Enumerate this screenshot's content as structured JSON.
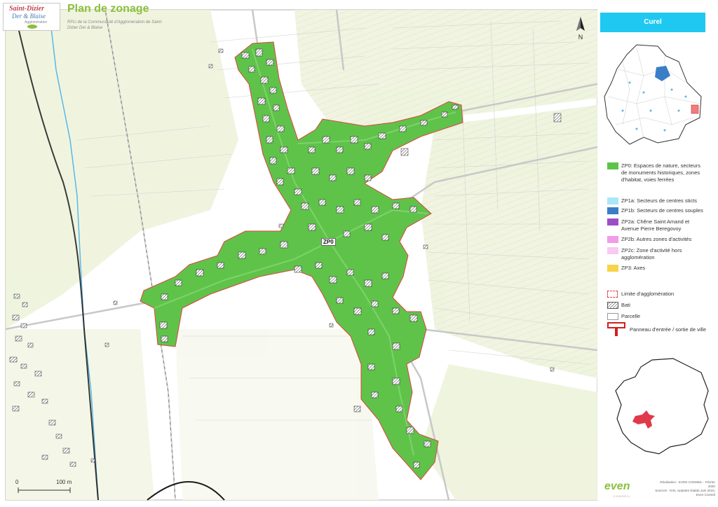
{
  "header": {
    "logo_line1": "Saint-Dizier",
    "logo_line2": "Der & Blaise",
    "logo_line3": "Agglomération",
    "title": "Plan de zonage",
    "subtitle": "RPLi de la Communauté d'Agglomération de Saint-Dizier Der & Blaise"
  },
  "map": {
    "north_label": "N",
    "zone_label": "ZP0",
    "scale_start": "0",
    "scale_end": "100 m",
    "colors": {
      "zone_fill": "#5fc34a",
      "zone_border": "#e04040",
      "parcel_line": "#cfcfcf",
      "terrain": "#eaf0d6",
      "river": "#5ab7e6",
      "railway": "#999999"
    }
  },
  "panel": {
    "commune_name": "Curel",
    "legend": [
      {
        "label": "ZP0: Espaces de nature, secteurs de monuments historiques, zones d'habitat, voies ferrées",
        "color": "#5fc34a"
      },
      {
        "label": "ZP1a: Secteurs de centres sticts",
        "color": "#a8e8f8"
      },
      {
        "label": "ZP1b: Secteurs de centres souples",
        "color": "#3a7ec8"
      },
      {
        "label": "ZP2a: Chêne Saint Amand et Avenue Pierre Beregovoy",
        "color": "#9b4fc7"
      },
      {
        "label": "ZP2b: Autres zones d'activités",
        "color": "#f29be6"
      },
      {
        "label": "ZP2c: Zone d'activité hors agglomération",
        "color": "#f9c9ef"
      },
      {
        "label": "ZP3: Axes",
        "color": "#f7d44a"
      }
    ],
    "legend2": [
      {
        "label": "Limite d'agglomération",
        "icon": "dashed-red-border"
      },
      {
        "label": "Bati",
        "icon": "hatched-square"
      },
      {
        "label": "Parcelle",
        "icon": "white-square"
      },
      {
        "label": "Panneau d'entrée / sortie de ville",
        "icon": "red-sign"
      }
    ],
    "credits": [
      "Réalisation : EVEN CONSEIL - Février 2020",
      "Sources : IGN, cadastre Etalab Juin 2019,",
      "Even Conseil"
    ],
    "brand": "even",
    "brand_sub": "CONSEIL"
  }
}
